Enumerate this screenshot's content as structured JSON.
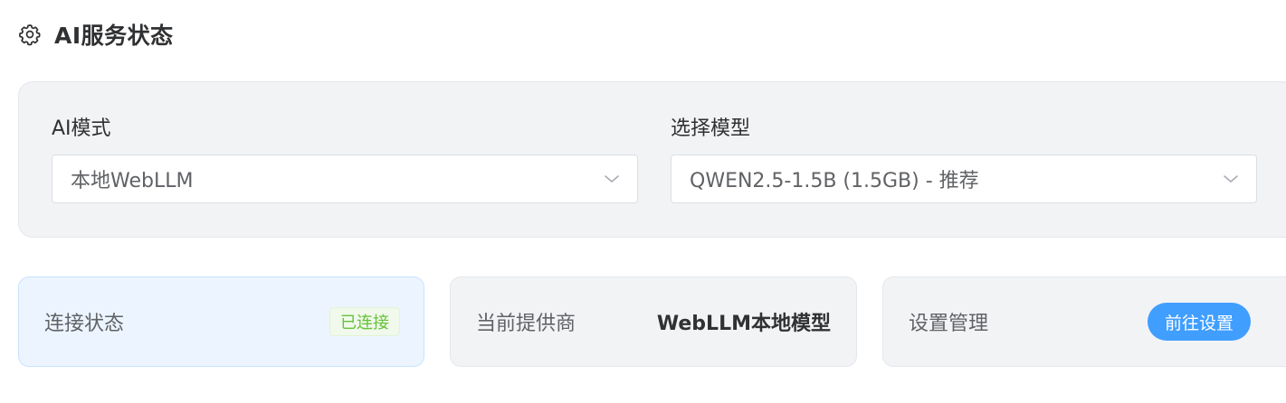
{
  "header": {
    "icon": "gear-icon",
    "title": "AI服务状态"
  },
  "config": {
    "mode": {
      "label": "AI模式",
      "selected": "本地WebLLM"
    },
    "model": {
      "label": "选择模型",
      "selected": "QWEN2.5-1.5B (1.5GB) - 推荐"
    }
  },
  "status": {
    "connection": {
      "label": "连接状态",
      "badge": "已连接",
      "badge_color": "#67c23a"
    },
    "provider": {
      "label": "当前提供商",
      "value": "WebLLM本地模型"
    },
    "settings": {
      "label": "设置管理",
      "button": "前往设置",
      "button_color": "#409eff"
    }
  },
  "colors": {
    "accent": "#409eff",
    "success": "#67c23a",
    "card_bg": "#f2f3f5",
    "connected_bg": "#ecf5ff"
  }
}
